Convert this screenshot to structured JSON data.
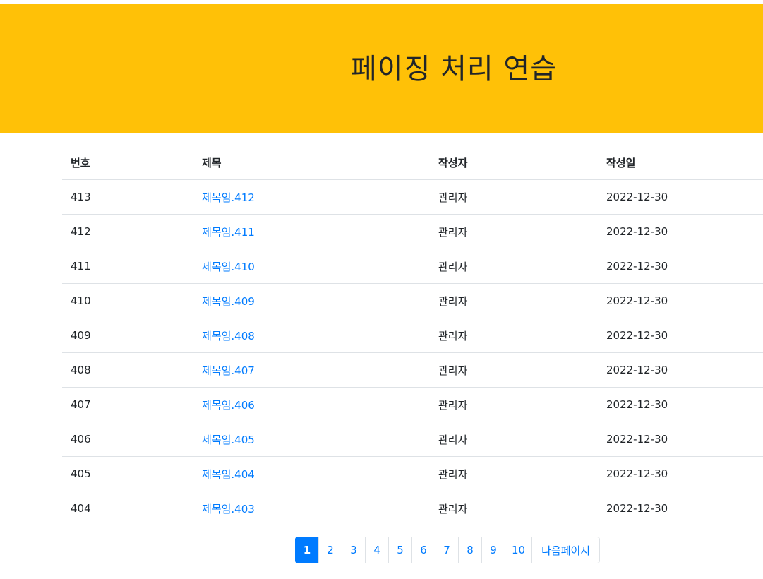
{
  "header": {
    "title": "페이징 처리 연습"
  },
  "table": {
    "columns": {
      "no": "번호",
      "title": "제목",
      "writer": "작성자",
      "date": "작성일"
    },
    "rows": [
      {
        "no": "413",
        "title": "제목임.412",
        "writer": "관리자",
        "date": "2022-12-30"
      },
      {
        "no": "412",
        "title": "제목임.411",
        "writer": "관리자",
        "date": "2022-12-30"
      },
      {
        "no": "411",
        "title": "제목임.410",
        "writer": "관리자",
        "date": "2022-12-30"
      },
      {
        "no": "410",
        "title": "제목임.409",
        "writer": "관리자",
        "date": "2022-12-30"
      },
      {
        "no": "409",
        "title": "제목임.408",
        "writer": "관리자",
        "date": "2022-12-30"
      },
      {
        "no": "408",
        "title": "제목임.407",
        "writer": "관리자",
        "date": "2022-12-30"
      },
      {
        "no": "407",
        "title": "제목임.406",
        "writer": "관리자",
        "date": "2022-12-30"
      },
      {
        "no": "406",
        "title": "제목임.405",
        "writer": "관리자",
        "date": "2022-12-30"
      },
      {
        "no": "405",
        "title": "제목임.404",
        "writer": "관리자",
        "date": "2022-12-30"
      },
      {
        "no": "404",
        "title": "제목임.403",
        "writer": "관리자",
        "date": "2022-12-30"
      }
    ]
  },
  "pagination": {
    "pages": [
      "1",
      "2",
      "3",
      "4",
      "5",
      "6",
      "7",
      "8",
      "9",
      "10"
    ],
    "active": "1",
    "next_label": "다음페이지"
  },
  "colors": {
    "banner": "#ffc107",
    "link": "#007bff",
    "active_page": "#007bff"
  }
}
